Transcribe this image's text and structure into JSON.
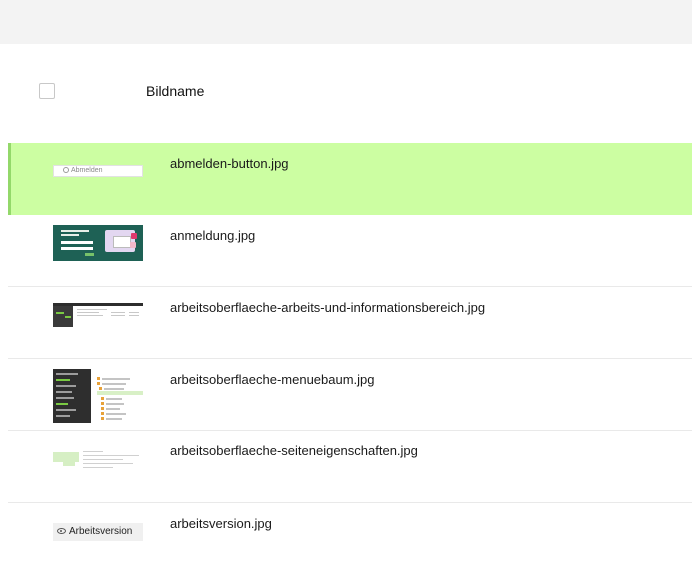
{
  "table": {
    "column_header": "Bildname",
    "rows": [
      {
        "filename": "abmelden-button.jpg",
        "selected": true,
        "thumb_text": "Abmelden"
      },
      {
        "filename": "anmeldung.jpg",
        "selected": false
      },
      {
        "filename": "arbeitsoberflaeche-arbeits-und-informationsbereich.jpg",
        "selected": false
      },
      {
        "filename": "arbeitsoberflaeche-menuebaum.jpg",
        "selected": false
      },
      {
        "filename": "arbeitsoberflaeche-seiteneigenschaften.jpg",
        "selected": false
      },
      {
        "filename": "arbeitsversion.jpg",
        "selected": false,
        "thumb_text": "Arbeitsversion"
      }
    ]
  },
  "colors": {
    "selected_row_bg": "#ccfea2",
    "selected_row_accent": "#93d86a",
    "topbar_bg": "#f3f3f3"
  },
  "icons": [
    "checkbox-icon",
    "gear-icon",
    "eye-icon"
  ]
}
